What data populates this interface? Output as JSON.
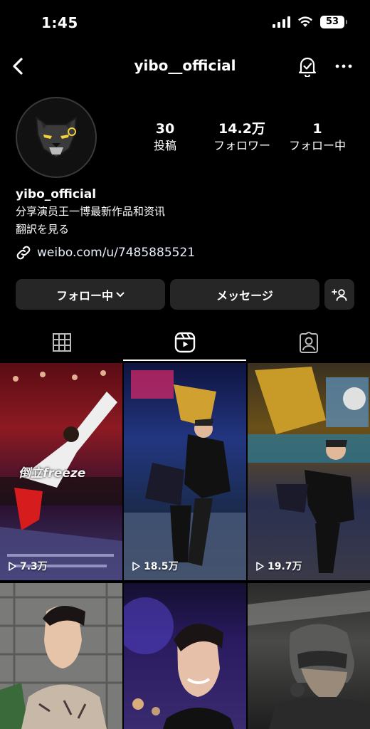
{
  "status_bar": {
    "time": "1:45",
    "battery": "53"
  },
  "header": {
    "username": "yibo__official"
  },
  "profile": {
    "stats": [
      {
        "value": "30",
        "label": "投稿"
      },
      {
        "value": "14.2万",
        "label": "フォロワー"
      },
      {
        "value": "1",
        "label": "フォロー中"
      }
    ],
    "name": "yibo_official",
    "bio": "分享演员王一博最新作品和资讯",
    "translate": "翻訳を見る",
    "link": "weibo.com/u/7485885521"
  },
  "actions": {
    "following": "フォロー中",
    "message": "メッセージ"
  },
  "tabs": [
    "grid-icon",
    "reels-icon",
    "tagged-icon"
  ],
  "reels": [
    {
      "views": "7.3万",
      "overlay_text": "倒立freeze"
    },
    {
      "views": "18.5万"
    },
    {
      "views": "19.7万"
    },
    {
      "views": ""
    },
    {
      "views": ""
    },
    {
      "views": ""
    }
  ],
  "colors": {
    "background": "#000000",
    "button": "#262626",
    "text": "#ffffff",
    "link": "#e8eefc"
  }
}
